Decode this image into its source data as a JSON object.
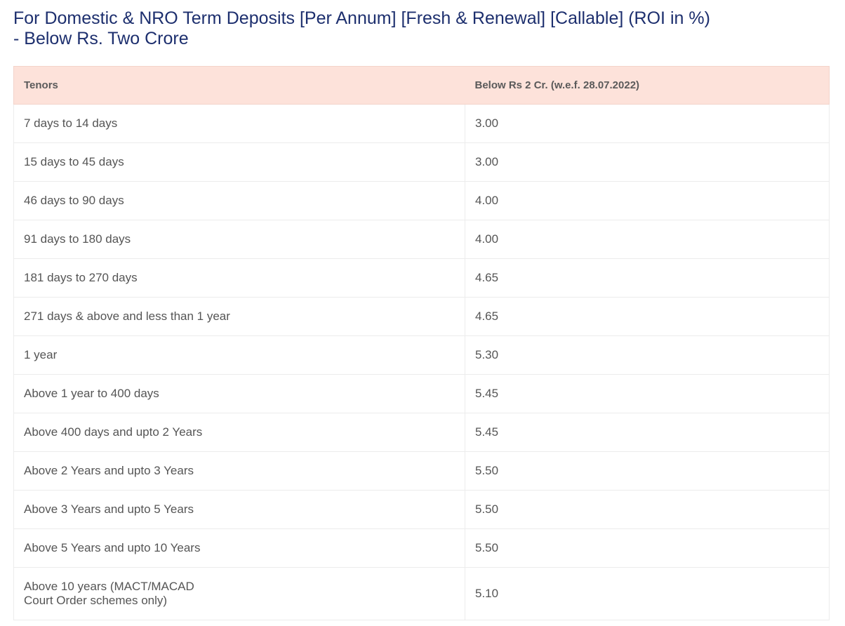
{
  "title": {
    "line1": "For Domestic & NRO Term Deposits [Per Annum] [Fresh & Renewal] [Callable] (ROI in %)",
    "line2": "- Below Rs. Two Crore"
  },
  "table": {
    "headers": [
      "Tenors",
      "Below Rs 2 Cr. (w.e.f. 28.07.2022)"
    ],
    "rows": [
      {
        "tenor": "7 days to 14 days",
        "rate": "3.00"
      },
      {
        "tenor": "15 days to 45 days",
        "rate": "3.00"
      },
      {
        "tenor": "46 days to 90 days",
        "rate": "4.00"
      },
      {
        "tenor": "91 days to 180 days",
        "rate": "4.00"
      },
      {
        "tenor": "181 days to 270 days",
        "rate": "4.65"
      },
      {
        "tenor": "271 days & above and less than 1 year",
        "rate": "4.65"
      },
      {
        "tenor": "1 year",
        "rate": "5.30"
      },
      {
        "tenor": "Above 1 year to 400 days",
        "rate": "5.45"
      },
      {
        "tenor": "Above 400 days and upto 2 Years",
        "rate": "5.45"
      },
      {
        "tenor": "Above 2 Years and upto 3 Years",
        "rate": "5.50"
      },
      {
        "tenor": "Above 3 Years and upto 5 Years",
        "rate": "5.50"
      },
      {
        "tenor": "Above 5 Years and upto 10 Years",
        "rate": "5.50"
      },
      {
        "tenor": "Above 10 years (MACT/MACAD\nCourt Order schemes only)",
        "rate": "5.10"
      }
    ]
  }
}
